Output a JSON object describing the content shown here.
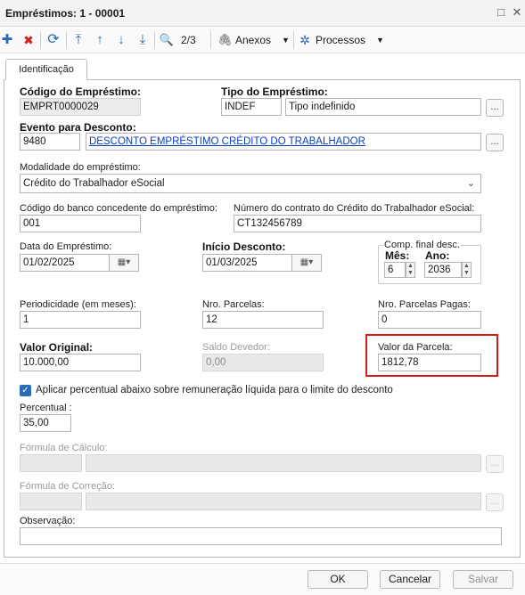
{
  "window": {
    "title": "Empréstimos: 1 - 00001",
    "maximize_icon": "□",
    "close_icon": "✕"
  },
  "toolbar": {
    "add_icon": "✚",
    "delete_icon": "✖",
    "refresh_icon": "⟳",
    "first_icon": "⤒",
    "prev_icon": "↑",
    "next_icon": "↓",
    "last_icon": "⤓",
    "search_icon": "🔍",
    "page_indicator": "2/3",
    "attachments_label": "Anexos",
    "processes_label": "Processos",
    "dropdown_arrow": "▼",
    "attachment_icon": "🖇",
    "gear_icon": "✲"
  },
  "tab": {
    "label": "Identificação"
  },
  "form": {
    "codigo_label": "Código do Empréstimo:",
    "codigo_value": "EMPRT0000029",
    "tipo_label": "Tipo do Empréstimo:",
    "tipo_code": "INDEF",
    "tipo_desc": "Tipo indefinido",
    "lookup_btn": "...",
    "evento_label": "Evento para Desconto:",
    "evento_code": "9480",
    "evento_desc": "DESCONTO EMPRÉSTIMO CRÉDITO DO TRABALHADOR",
    "modalidade_label": "Modalidade do empréstimo:",
    "modalidade_value": "Crédito do Trabalhador eSocial",
    "modalidade_arrow": "⌄",
    "banco_label": "Código do banco concedente do empréstimo:",
    "banco_value": "001",
    "contrato_label": "Número do contrato do Crédito do Trabalhador eSocial:",
    "contrato_value": "CT132456789",
    "data_label": "Data do Empréstimo:",
    "data_value": "01/02/2025",
    "inicio_label": "Início Desconto:",
    "inicio_value": "01/03/2025",
    "cal_btn": "▦▾",
    "comp_label": "Comp. final desc.",
    "mes_label": "Mês:",
    "mes_value": "6",
    "ano_label": "Ano:",
    "ano_value": "2036",
    "spin_up": "▲",
    "spin_down": "▼",
    "periodicidade_label": "Periodicidade (em meses):",
    "periodicidade_value": "1",
    "nro_parcelas_label": "Nro. Parcelas:",
    "nro_parcelas_value": "12",
    "parcelas_pagas_label": "Nro. Parcelas Pagas:",
    "parcelas_pagas_value": "0",
    "valor_original_label": "Valor Original:",
    "valor_original_value": "10.000,00",
    "saldo_label": "Saldo Devedor:",
    "saldo_value": "0,00",
    "valor_parcela_label": "Valor da Parcela:",
    "valor_parcela_value": "1812,78",
    "aplicar_label": "Aplicar percentual abaixo sobre remuneração líquida para o limite do desconto",
    "check_mark": "✓",
    "percentual_label": "Percentual :",
    "percentual_value": "35,00",
    "formula_calculo_label": "Fórmula de Cálculo:",
    "formula_correcao_label": "Fórmula de Correção:",
    "observacao_label": "Observação:"
  },
  "footer": {
    "ok_label": "OK",
    "cancel_label": "Cancelar",
    "save_label": "Salvar"
  }
}
